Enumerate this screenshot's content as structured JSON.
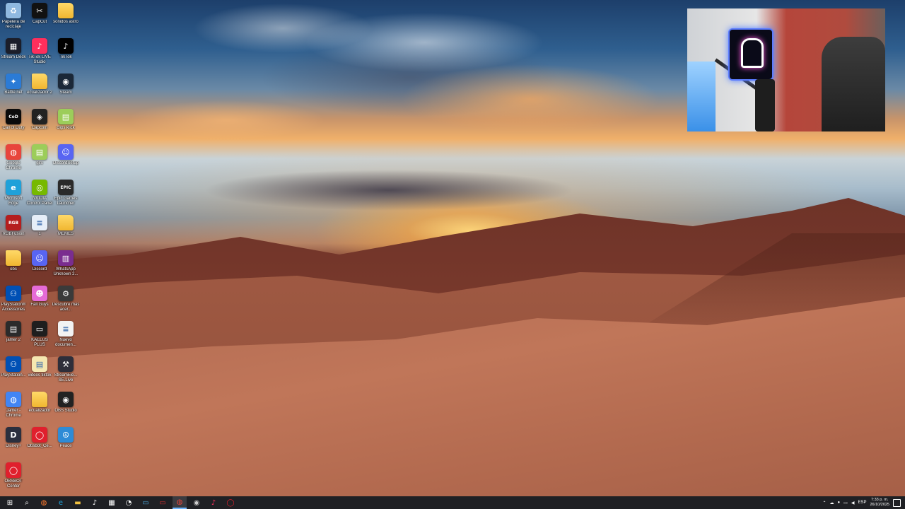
{
  "desktop": {
    "icons": [
      {
        "label": "Papelera de reciclaje",
        "icon": "recycle-bin-icon",
        "color": "#8fb9e0",
        "glyph": "♻"
      },
      {
        "label": "CapCut",
        "icon": "capcut-icon",
        "color": "#111111",
        "glyph": "✂"
      },
      {
        "label": "sonidos astro",
        "icon": "folder-icon",
        "color": "folder",
        "glyph": ""
      },
      {
        "label": "Stream Deck",
        "icon": "stream-deck-icon",
        "color": "#1b1e2a",
        "glyph": "▦"
      },
      {
        "label": "TikTok LIVE Studio",
        "icon": "tiktok-live-icon",
        "color": "#ff2f5c",
        "glyph": "♪"
      },
      {
        "label": "TikTok",
        "icon": "tiktok-icon",
        "color": "#000000",
        "glyph": "♪"
      },
      {
        "label": "Battle.net",
        "icon": "battlenet-icon",
        "color": "#2b7bd6",
        "glyph": "✦"
      },
      {
        "label": "ecualizador 2",
        "icon": "folder-icon",
        "color": "folder",
        "glyph": ""
      },
      {
        "label": "Steam",
        "icon": "steam-icon",
        "color": "#1b2838",
        "glyph": "◉"
      },
      {
        "label": "Call of Duty",
        "icon": "call-of-duty-icon",
        "color": "#0b0b0b",
        "glyph": "CoD"
      },
      {
        "label": "Capcom",
        "icon": "capture-icon",
        "color": "#222222",
        "glyph": "◈"
      },
      {
        "label": "clips klick",
        "icon": "archive-icon",
        "color": "#9ccd5a",
        "glyph": "▤"
      },
      {
        "label": "Google Chrome",
        "icon": "chrome-icon",
        "color": "#e8453c",
        "glyph": "◍"
      },
      {
        "label": "gifs",
        "icon": "archive-icon",
        "color": "#9ccd5a",
        "glyph": "▤"
      },
      {
        "label": "DiscordSetup",
        "icon": "discord-icon",
        "color": "#5865f2",
        "glyph": "☺"
      },
      {
        "label": "Microsoft Edge",
        "icon": "edge-icon",
        "color": "#1fa1d9",
        "glyph": "e"
      },
      {
        "label": "NVIDIA Control Panel",
        "icon": "nvidia-icon",
        "color": "#76b900",
        "glyph": "◎"
      },
      {
        "label": "Epic Games Launcher",
        "icon": "epic-games-icon",
        "color": "#2a2a2a",
        "glyph": "EPIC"
      },
      {
        "label": "RGBFusion",
        "icon": "rgb-fusion-icon",
        "color": "#b51e1e",
        "glyph": "RGB"
      },
      {
        "label": "1",
        "icon": "document-icon",
        "color": "#e6eef8",
        "glyph": "≡"
      },
      {
        "label": "MEMES",
        "icon": "folder-icon",
        "color": "folder",
        "glyph": ""
      },
      {
        "label": "obs",
        "icon": "folder-icon",
        "color": "folder",
        "glyph": ""
      },
      {
        "label": "Discord",
        "icon": "discord-icon",
        "color": "#5865f2",
        "glyph": "☺"
      },
      {
        "label": "WhatsApp Unknown 2...",
        "icon": "winrar-icon",
        "color": "#7a2d8f",
        "glyph": "▥"
      },
      {
        "label": "PlayStation® Accessories",
        "icon": "playstation-icon",
        "color": "#0050b5",
        "glyph": "⚇"
      },
      {
        "label": "Fall Guys",
        "icon": "fall-guys-icon",
        "color": "#e56bd6",
        "glyph": "☻"
      },
      {
        "label": "Descubre más acer...",
        "icon": "acer-icon",
        "color": "#3a3a3a",
        "glyph": "⚙"
      },
      {
        "label": "jamer 2",
        "icon": "archive-icon",
        "color": "#2b2b2b",
        "glyph": "▤"
      },
      {
        "label": "KAELUS PLUS",
        "icon": "kaelus-icon",
        "color": "#1e1e1e",
        "glyph": "▭"
      },
      {
        "label": "Nuevo documen...",
        "icon": "text-document-icon",
        "color": "#f2f2f2",
        "glyph": "≡"
      },
      {
        "label": "PlayStation...",
        "icon": "playstation-icon",
        "color": "#0050b5",
        "glyph": "⚇"
      },
      {
        "label": "videos tiktok",
        "icon": "document-icon",
        "color": "#f5e7b0",
        "glyph": "▤"
      },
      {
        "label": "StreamEle... SE.Live",
        "icon": "streamelements-icon",
        "color": "#2e2e3a",
        "glyph": "⚒"
      },
      {
        "label": "Jamer - Chrome",
        "icon": "chrome-profile-icon",
        "color": "#4285f4",
        "glyph": "◍"
      },
      {
        "label": "ecualizador",
        "icon": "folder-icon",
        "color": "folder",
        "glyph": ""
      },
      {
        "label": "OBS Studio",
        "icon": "obs-icon",
        "color": "#222222",
        "glyph": "◉"
      },
      {
        "label": "Disney+",
        "icon": "disney-plus-icon",
        "color": "#2b2f3e",
        "glyph": "D"
      },
      {
        "label": "Obsbot_Ce...",
        "icon": "obsbot-icon",
        "color": "#e0202d",
        "glyph": "◯"
      },
      {
        "label": "Peace",
        "icon": "peace-icon",
        "color": "#2e8bd6",
        "glyph": "☮"
      },
      {
        "label": "OBSBOT Center",
        "icon": "obsbot-icon",
        "color": "#e0202d",
        "glyph": "◯"
      }
    ]
  },
  "taskbar": {
    "apps": [
      {
        "name": "start-button",
        "glyph": "⊞",
        "color": "#ffffff"
      },
      {
        "name": "search-icon",
        "glyph": "⌕",
        "color": "#ffffff"
      },
      {
        "name": "app-browser-icon",
        "glyph": "◍",
        "color": "#ff7a2d"
      },
      {
        "name": "edge-icon",
        "glyph": "e",
        "color": "#1fa1d9"
      },
      {
        "name": "file-explorer-icon",
        "glyph": "▬",
        "color": "#f0c040"
      },
      {
        "name": "tiktok-icon",
        "glyph": "♪",
        "color": "#ffffff"
      },
      {
        "name": "stream-deck-icon",
        "glyph": "▦",
        "color": "#ffffff"
      },
      {
        "name": "speedtest-icon",
        "glyph": "◔",
        "color": "#ffffff"
      },
      {
        "name": "app-window-icon",
        "glyph": "▭",
        "color": "#4aa3d6"
      },
      {
        "name": "kaelus-icon",
        "glyph": "▭",
        "color": "#d03030"
      },
      {
        "name": "chrome-icon",
        "glyph": "◍",
        "color": "#e8453c"
      },
      {
        "name": "obs-icon",
        "glyph": "◉",
        "color": "#cccccc"
      },
      {
        "name": "tiktok-live-icon",
        "glyph": "♪",
        "color": "#ff2f5c"
      },
      {
        "name": "obsbot-icon",
        "glyph": "◯",
        "color": "#e0202d"
      }
    ],
    "tray": {
      "language": "ESP",
      "time": "7:33 p. m.",
      "date": "26/10/2025"
    }
  }
}
